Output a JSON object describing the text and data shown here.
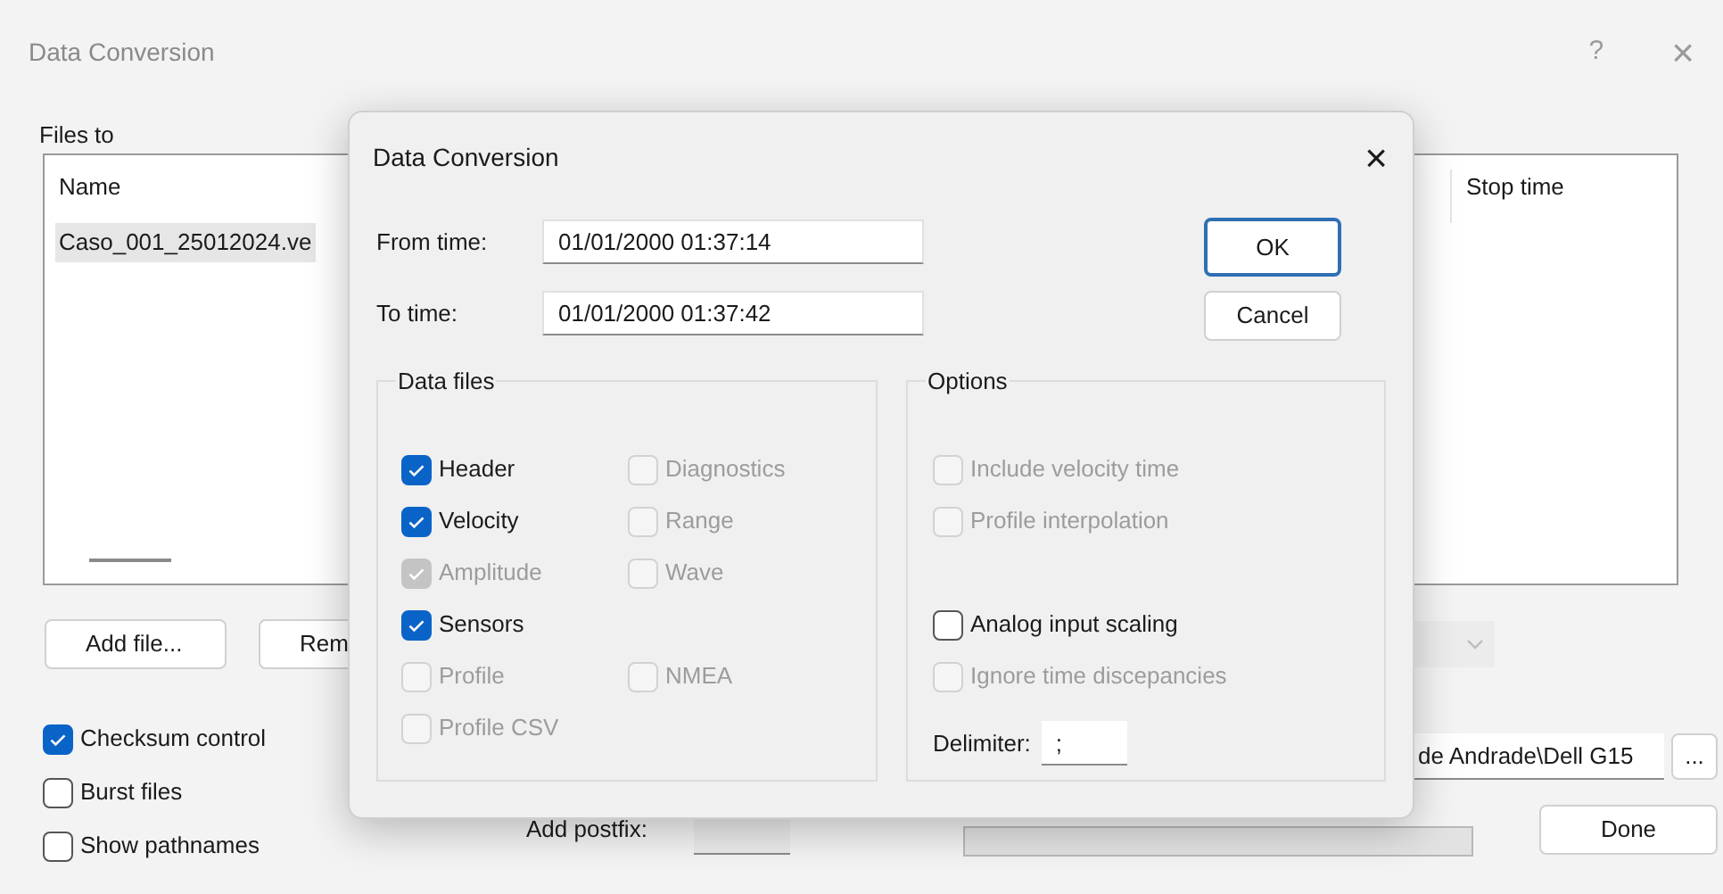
{
  "window": {
    "title": "Data Conversion",
    "help": "?",
    "close": "×"
  },
  "files_label": "Files to",
  "file_list": {
    "columns": [
      "Name",
      "Stop time"
    ],
    "rows": [
      {
        "name": "Caso_001_25012024.ve",
        "selected": true
      }
    ]
  },
  "list_buttons": [
    "Add file...",
    "Rem"
  ],
  "options": [
    {
      "label": "Checksum control",
      "checked": true
    },
    {
      "label": "Burst files",
      "checked": false
    },
    {
      "label": "Show pathnames",
      "checked": false
    }
  ],
  "output_path": {
    "value": "de Andrade\\Dell G15",
    "browse": "..."
  },
  "postfix": {
    "label": "Add postfix:"
  },
  "progress": {
    "level": 0
  },
  "done_button": "Done",
  "dialog": {
    "title": "Data Conversion",
    "close": "×",
    "from_time": {
      "label": "From time:",
      "value": "01/01/2000 01:37:14"
    },
    "to_time": {
      "label": "To time:",
      "value": "01/01/2000 01:37:42"
    },
    "ok_button": "OK",
    "cancel_button": "Cancel",
    "data_files": {
      "title": "Data files",
      "rows": [
        [
          {
            "label": "Header",
            "checked": true,
            "disabled": false
          },
          {
            "label": "Diagnostics",
            "checked": false,
            "disabled": true
          }
        ],
        [
          {
            "label": "Velocity",
            "checked": true,
            "disabled": false
          },
          {
            "label": "Range",
            "checked": false,
            "disabled": true
          }
        ],
        [
          {
            "label": "Amplitude",
            "checked": true,
            "disabled": true
          },
          {
            "label": "Wave",
            "checked": false,
            "disabled": true
          }
        ],
        [
          {
            "label": "Sensors",
            "checked": true,
            "disabled": false
          }
        ],
        [
          {
            "label": "Profile",
            "checked": false,
            "disabled": true
          },
          {
            "label": "NMEA",
            "checked": false,
            "disabled": true
          }
        ],
        [
          {
            "label": "Profile CSV",
            "checked": false,
            "disabled": true
          }
        ]
      ]
    },
    "options_group": {
      "title": "Options",
      "groups": [
        [
          {
            "label": "Include velocity time",
            "checked": false,
            "disabled": true
          },
          {
            "label": "Profile interpolation",
            "checked": false,
            "disabled": true
          }
        ],
        [
          {
            "label": "Analog input scaling",
            "checked": false,
            "disabled": false
          },
          {
            "label": "Ignore time discepancies",
            "checked": false,
            "disabled": true
          }
        ]
      ],
      "delimiter": {
        "label": "Delimiter:",
        "value": ";"
      }
    }
  }
}
